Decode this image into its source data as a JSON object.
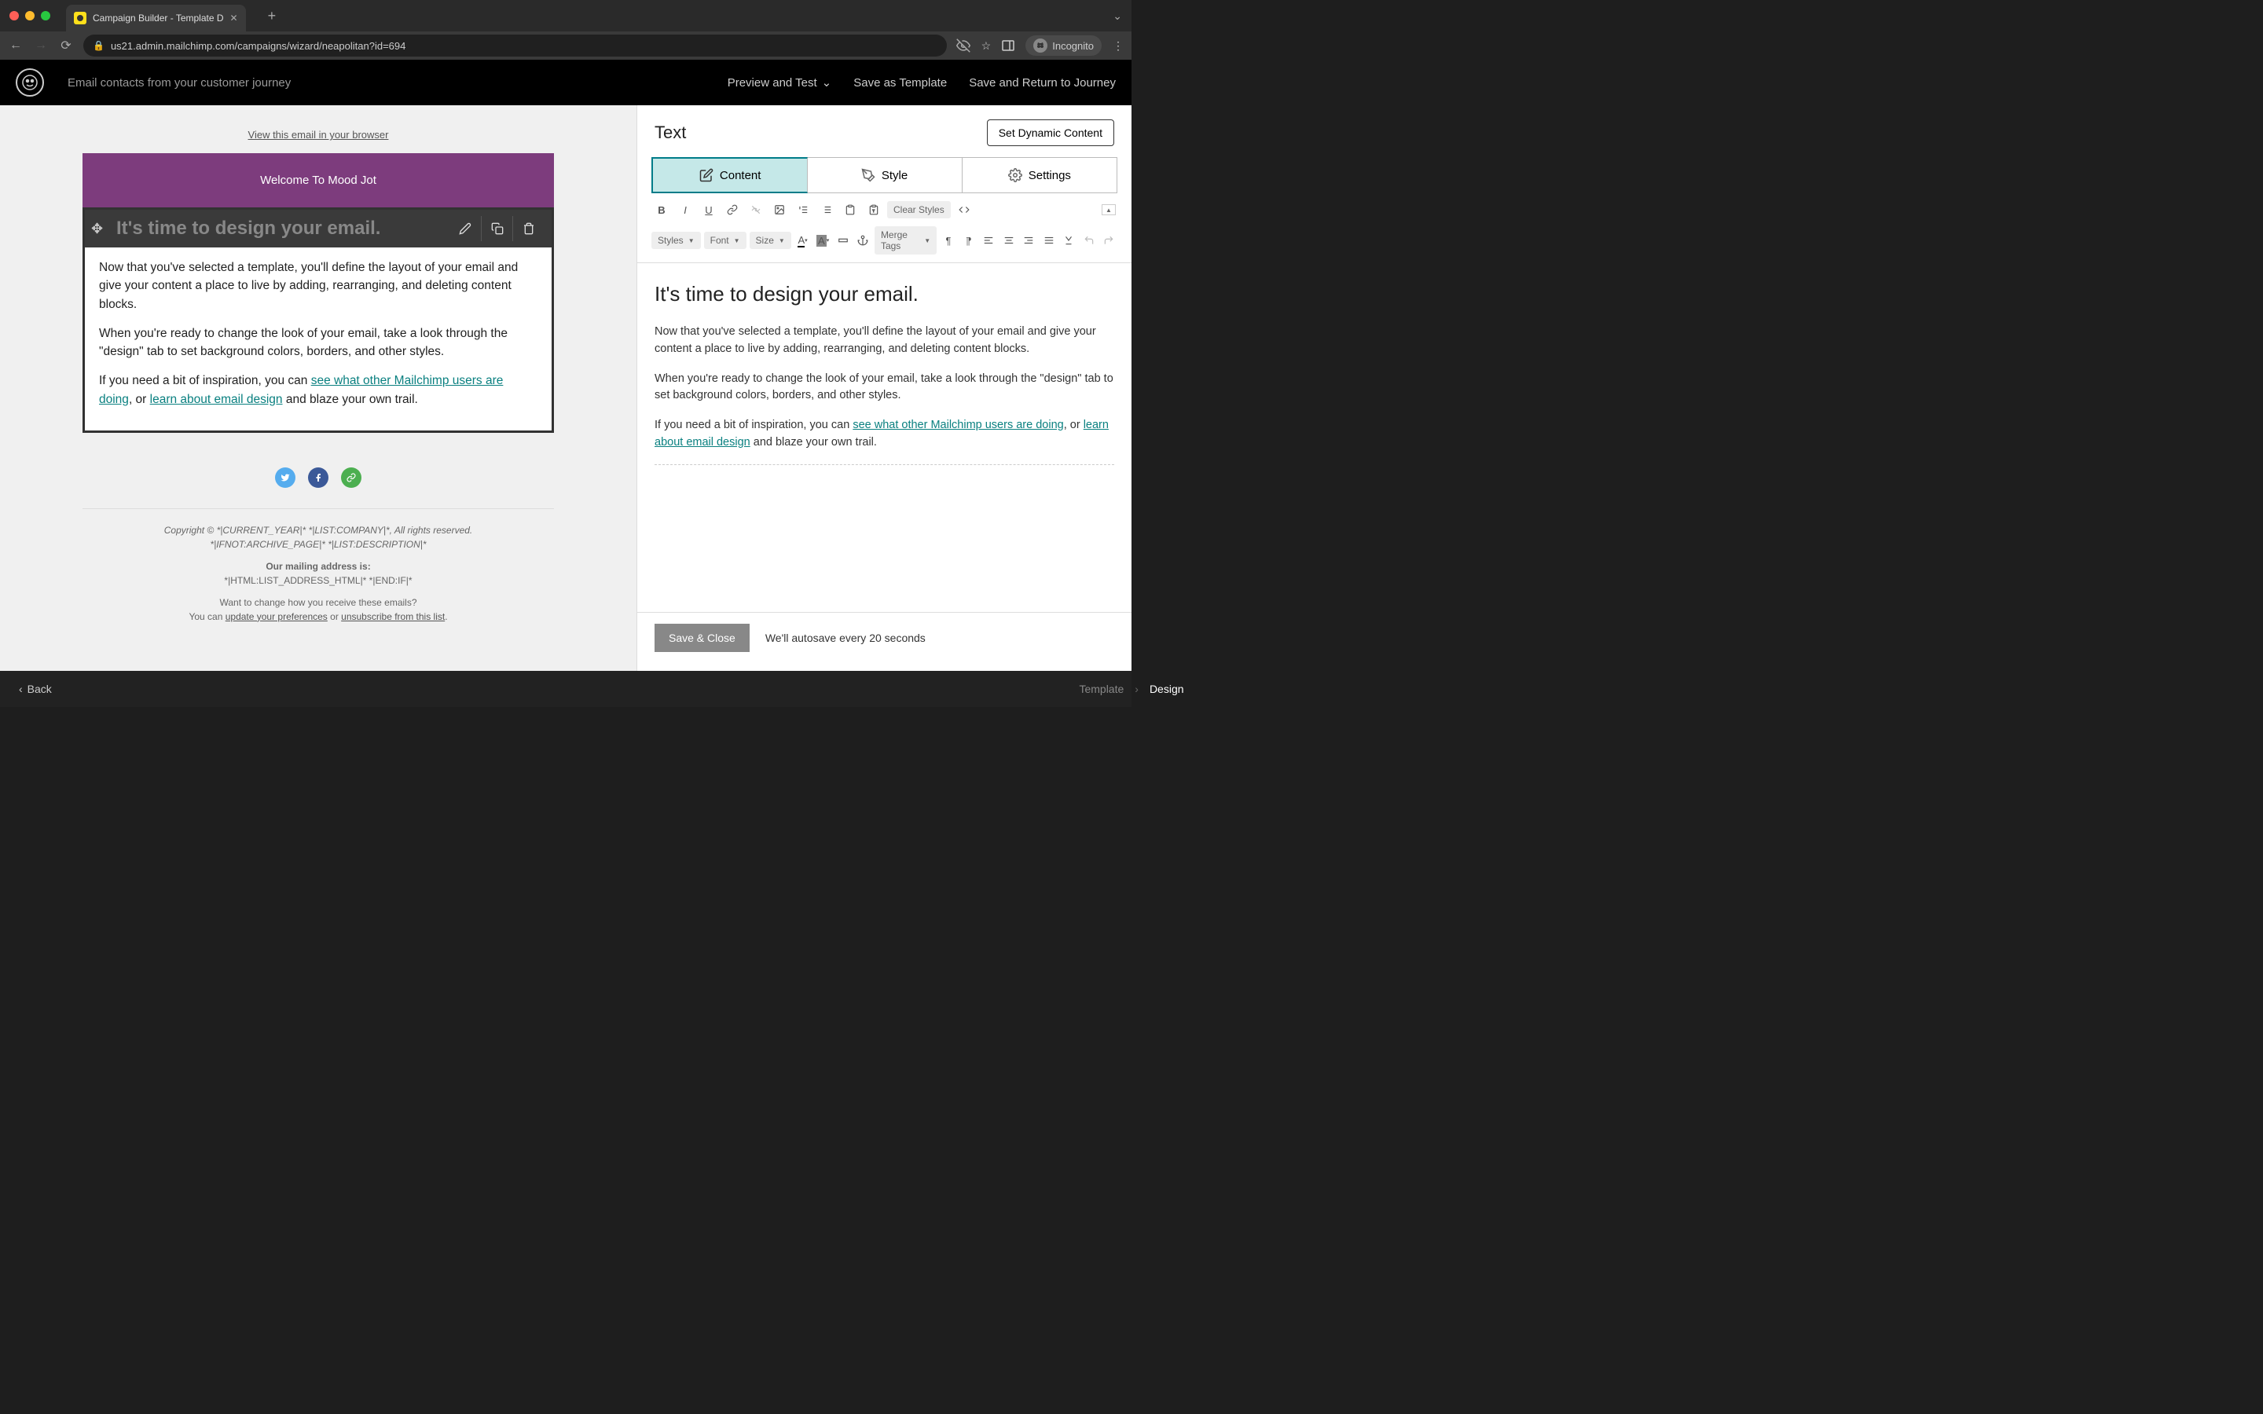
{
  "browser": {
    "tab_title": "Campaign Builder - Template D",
    "url": "us21.admin.mailchimp.com/campaigns/wizard/neapolitan?id=694",
    "incognito": "Incognito"
  },
  "header": {
    "app_title": "Email contacts from your customer journey",
    "preview": "Preview and Test",
    "save_template": "Save as Template",
    "save_return": "Save and Return to Journey"
  },
  "canvas": {
    "view_browser": "View this email in your browser",
    "welcome": "Welcome To Mood Jot",
    "heading": "It's time to design your email.",
    "para1": "Now that you've selected a template, you'll define the layout of your email and give your content a place to live by adding, rearranging, and deleting content blocks.",
    "para2": "When you're ready to change the look of your email, take a look through the \"design\" tab to set background colors, borders, and other styles.",
    "para3_pre": "If you need a bit of inspiration, you can ",
    "link1": "see what other Mailchimp users are doing",
    "para3_mid": ", or ",
    "link2": "learn about email design",
    "para3_post": " and blaze your own trail.",
    "footer": {
      "copyright": "Copyright © *|CURRENT_YEAR|* *|LIST:COMPANY|*, All rights reserved.",
      "archive": "*|IFNOT:ARCHIVE_PAGE|* *|LIST:DESCRIPTION|*",
      "mailing_label": "Our mailing address is:",
      "mailing": "*|HTML:LIST_ADDRESS_HTML|* *|END:IF|*",
      "change": "Want to change how you receive these emails?",
      "you_can": "You can ",
      "update": "update your preferences",
      "or": " or ",
      "unsub": "unsubscribe from this list",
      "period": "."
    }
  },
  "rpanel": {
    "title": "Text",
    "dynamic": "Set Dynamic Content",
    "tabs": {
      "content": "Content",
      "style": "Style",
      "settings": "Settings"
    },
    "toolbar": {
      "clear": "Clear Styles",
      "styles": "Styles",
      "font": "Font",
      "size": "Size",
      "merge": "Merge Tags"
    },
    "editor": {
      "h1": "It's time to design your email.",
      "p1": "Now that you've selected a template, you'll define the layout of your email and give your content a place to live by adding, rearranging, and deleting content blocks.",
      "p2": "When you're ready to change the look of your email, take a look through the \"design\" tab to set background colors, borders, and other styles.",
      "p3_pre": "If you need a bit of inspiration, you can ",
      "link1": "see what other Mailchimp users are doing",
      "p3_mid": ", or ",
      "link2": "learn about email design",
      "p3_post": " and blaze your own trail."
    },
    "save_close": "Save & Close",
    "autosave": "We'll autosave every 20 seconds"
  },
  "bottom": {
    "back": "Back",
    "template": "Template",
    "design": "Design"
  }
}
